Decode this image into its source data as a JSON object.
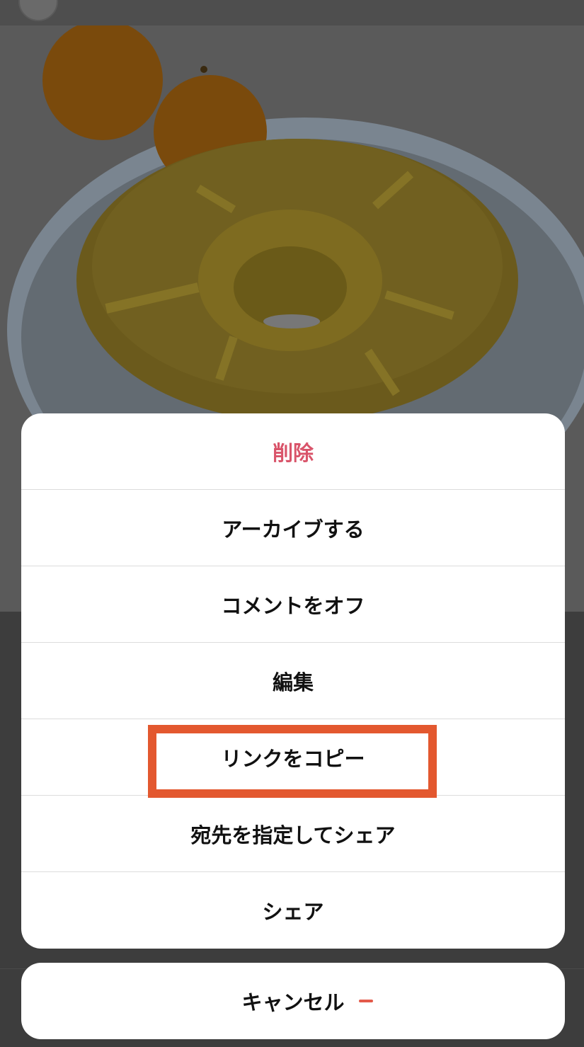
{
  "action_sheet": {
    "items": [
      {
        "label": "削除",
        "destructive": true
      },
      {
        "label": "アーカイブする"
      },
      {
        "label": "コメントをオフ"
      },
      {
        "label": "編集"
      },
      {
        "label": "リンクをコピー",
        "highlighted": true
      },
      {
        "label": "宛先を指定してシェア"
      },
      {
        "label": "シェア"
      }
    ],
    "cancel_label": "キャンセル"
  },
  "colors": {
    "destructive": "#d9546a",
    "highlight": "#e3582f",
    "overlay": "#3a3a3a"
  }
}
